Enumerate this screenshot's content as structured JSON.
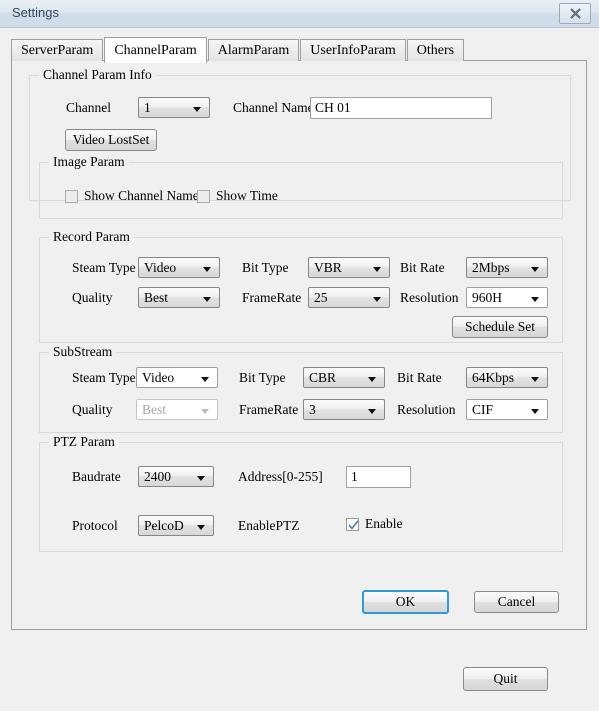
{
  "window": {
    "title": "Settings",
    "close_icon": "close-icon"
  },
  "tabs": [
    {
      "label": "ServerParam",
      "active": false
    },
    {
      "label": "ChannelParam",
      "active": true
    },
    {
      "label": "AlarmParam",
      "active": false
    },
    {
      "label": "UserInfoParam",
      "active": false
    },
    {
      "label": "Others",
      "active": false
    }
  ],
  "channel_param_info": {
    "legend": "Channel Param Info",
    "channel_label": "Channel",
    "channel_value": "1",
    "channel_name_label": "Channel Name",
    "channel_name_value": "CH 01",
    "video_lost_set_label": "Video LostSet"
  },
  "image_param": {
    "legend": "Image Param",
    "show_channel_name_label": "Show Channel Name",
    "show_channel_name_checked": false,
    "show_time_label": "Show Time",
    "show_time_checked": false
  },
  "record_param": {
    "legend": "Record Param",
    "steam_type_label": "Steam Type",
    "steam_type_value": "Video",
    "bit_type_label": "Bit Type",
    "bit_type_value": "VBR",
    "bit_rate_label": "Bit Rate",
    "bit_rate_value": "2Mbps",
    "quality_label": "Quality",
    "quality_value": "Best",
    "framerate_label": "FrameRate",
    "framerate_value": "25",
    "resolution_label": "Resolution",
    "resolution_value": "960H",
    "schedule_set_label": "Schedule Set"
  },
  "substream": {
    "legend": "SubStream",
    "steam_type_label": "Steam Type",
    "steam_type_value": "Video",
    "bit_type_label": "Bit Type",
    "bit_type_value": "CBR",
    "bit_rate_label": "Bit Rate",
    "bit_rate_value": "64Kbps",
    "quality_label": "Quality",
    "quality_value": "Best",
    "quality_disabled": true,
    "framerate_label": "FrameRate",
    "framerate_value": "3",
    "resolution_label": "Resolution",
    "resolution_value": "CIF"
  },
  "ptz_param": {
    "legend": "PTZ Param",
    "baudrate_label": "Baudrate",
    "baudrate_value": "2400",
    "address_label": "Address[0-255]",
    "address_value": "1",
    "protocol_label": "Protocol",
    "protocol_value": "PelcoD",
    "enable_ptz_label": "EnablePTZ",
    "enable_label": "Enable",
    "enable_checked": true
  },
  "footer": {
    "ok_label": "OK",
    "cancel_label": "Cancel",
    "quit_label": "Quit"
  },
  "colors": {
    "accent": "#2e9bd6",
    "titlebar": "#d2dde9",
    "window_bg": "#f0f0f0",
    "check_blue": "#4a7ebb"
  }
}
